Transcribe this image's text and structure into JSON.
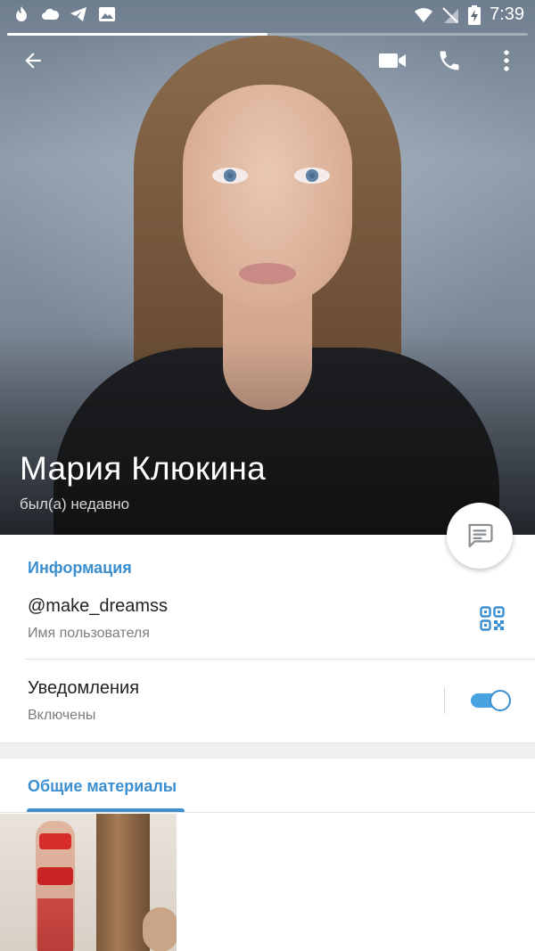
{
  "status_bar": {
    "time": "7:39",
    "left_icons": [
      "flame-icon",
      "cloud-icon",
      "telegram-icon",
      "image-icon"
    ],
    "right_icons": [
      "wifi-icon",
      "no-sim-icon",
      "battery-charging-icon"
    ]
  },
  "story_progress": {
    "fraction": 0.5
  },
  "header": {
    "name": "Мария Клюкина",
    "status": "был(а) недавно",
    "actions": [
      "back-arrow-icon",
      "video-call-icon",
      "phone-icon",
      "more-vertical-icon"
    ]
  },
  "info": {
    "section_title": "Информация",
    "username_value": "@make_dreamss",
    "username_label": "Имя пользователя",
    "notifications_title": "Уведомления",
    "notifications_state": "Включены",
    "notifications_enabled": true
  },
  "media": {
    "tab_label": "Общие материалы"
  },
  "colors": {
    "accent": "#3b8fd1",
    "toggle_track": "#4aa3e1"
  }
}
